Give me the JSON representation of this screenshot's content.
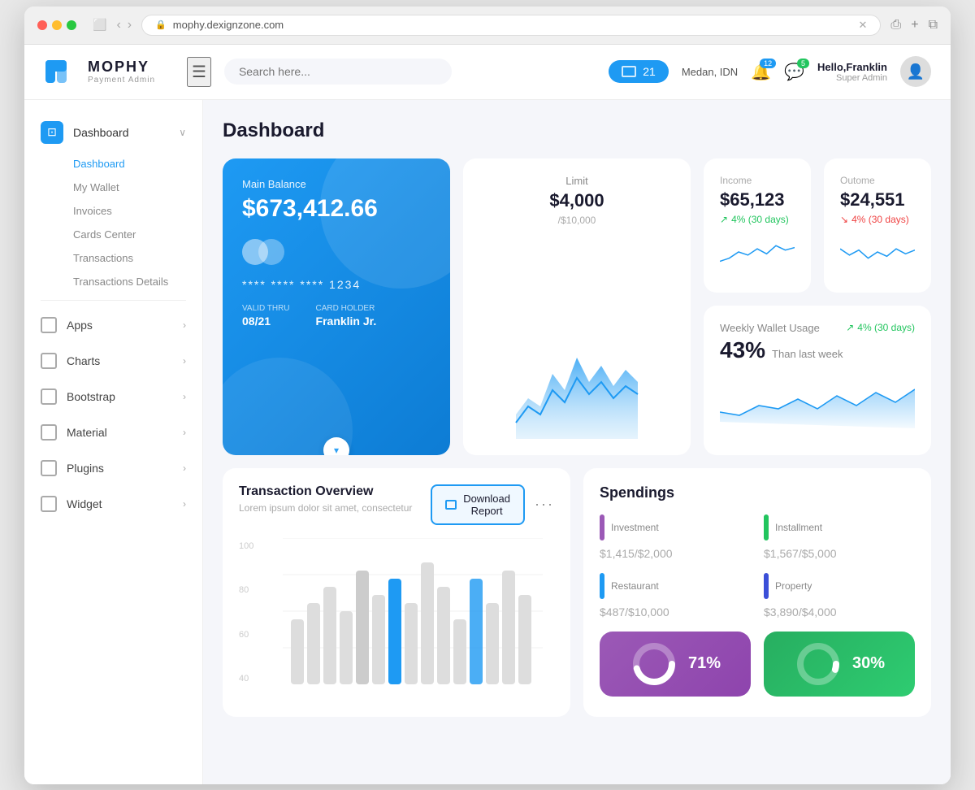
{
  "browser": {
    "url": "mophy.dexignzone.com",
    "tab_title": "mophy.dexignzone.com"
  },
  "header": {
    "logo_name": "MOPHY",
    "logo_subtitle": "Payment Admin",
    "search_placeholder": "Search here...",
    "badge_count": "21",
    "location": "Medan, IDN",
    "notif_count": "12",
    "message_count": "5",
    "greeting": "Hello,",
    "user_name": "Franklin",
    "user_role": "Super Admin"
  },
  "sidebar": {
    "main_item_label": "Dashboard",
    "sub_items": [
      {
        "label": "Dashboard",
        "active": true
      },
      {
        "label": "My Wallet"
      },
      {
        "label": "Invoices"
      },
      {
        "label": "Cards Center"
      },
      {
        "label": "Transactions"
      },
      {
        "label": "Transactions Details"
      }
    ],
    "nav_items": [
      {
        "label": "Apps"
      },
      {
        "label": "Charts"
      },
      {
        "label": "Bootstrap"
      },
      {
        "label": "Material"
      },
      {
        "label": "Plugins"
      },
      {
        "label": "Widget"
      }
    ]
  },
  "page": {
    "title": "Dashboard"
  },
  "balance_card": {
    "label": "Main Balance",
    "amount": "$673,412.66",
    "card_number": "**** **** **** 1234",
    "valid_thru_label": "VALID THRU",
    "valid_thru": "08/21",
    "card_holder_label": "CARD HOLDER",
    "card_holder": "Franklin Jr."
  },
  "limit_card": {
    "label": "Limit",
    "amount": "$4,000",
    "sub": "/$10,000"
  },
  "income_card": {
    "label": "Income",
    "amount": "$65,123",
    "change": "4% (30 days)"
  },
  "outcome_card": {
    "label": "Outome",
    "amount": "$24,551",
    "change": "4% (30 days)"
  },
  "weekly_card": {
    "title": "Weekly Wallet Usage",
    "percent": "43%",
    "desc": "Than last week",
    "change": "4% (30 days)"
  },
  "transaction_card": {
    "title": "Transaction Overview",
    "desc": "Lorem ipsum dolor sit amet, consectetur",
    "download_label": "Download\nReport",
    "chart_labels": [
      "100",
      "80",
      "60",
      "40"
    ]
  },
  "spendings_card": {
    "title": "Spendings",
    "items": [
      {
        "name": "Investment",
        "amount": "$1,415",
        "total": "/$2,000",
        "color": "#9b59b6"
      },
      {
        "name": "Installment",
        "amount": "$1,567",
        "total": "/$5,000",
        "color": "#22c55e"
      },
      {
        "name": "Restaurant",
        "amount": "$487",
        "total": "/$10,000",
        "color": "#1e9af3"
      },
      {
        "name": "Property",
        "amount": "$3,890",
        "total": "/$4,000",
        "color": "#3b4fd8"
      }
    ]
  },
  "donut1": {
    "percent": "71%",
    "percent_num": 71
  },
  "donut2": {
    "percent": "30%",
    "percent_num": 30
  }
}
